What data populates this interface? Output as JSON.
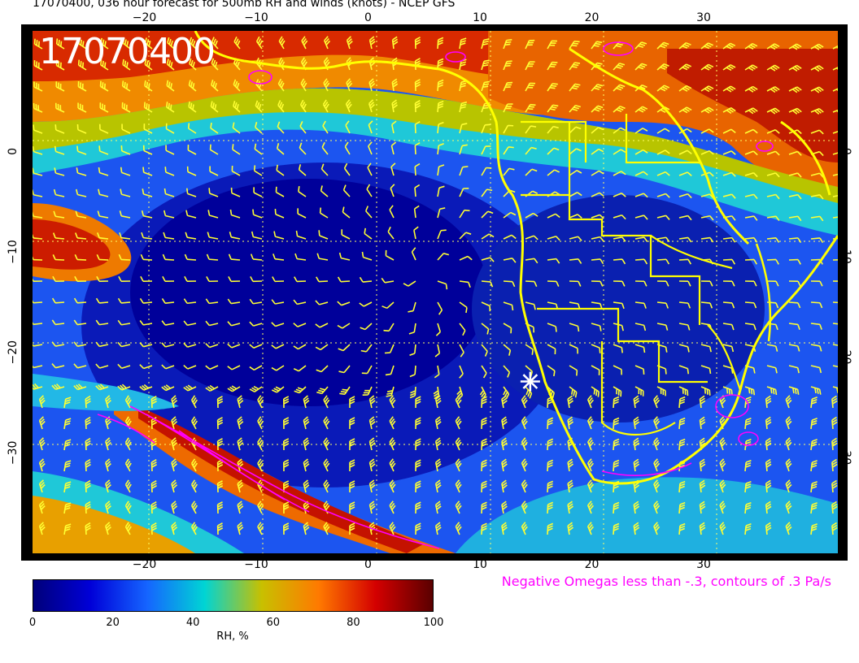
{
  "title": "17070400, 036 hour forecast for 500mb RH and winds (knots) - NCEP GFS",
  "stamp": "17070400",
  "omega_note": "Negative Omegas less than -.3, contours of .3 Pa/s",
  "map": {
    "lon_range": [
      -30,
      42
    ],
    "lat_range": [
      -40,
      12
    ],
    "lon_ticks": [
      "−20",
      "−10",
      "0",
      "10",
      "20",
      "30"
    ],
    "lat_ticks": [
      "0",
      "−10",
      "−20",
      "−30"
    ],
    "marker": {
      "lon": 14.5,
      "lat": -22.9,
      "color": "#ffffff"
    },
    "barb_color": "#ffff33",
    "coast_color": "#ffff00",
    "omega_color": "#ff00ff"
  },
  "colorbar": {
    "label": "RH, %",
    "ticks": [
      "0",
      "20",
      "40",
      "60",
      "80",
      "100"
    ],
    "stops": [
      "#00007a",
      "#0000d8",
      "#1565ff",
      "#00d4d4",
      "#c8c000",
      "#ff7a00",
      "#d40000",
      "#5a0000"
    ]
  }
}
